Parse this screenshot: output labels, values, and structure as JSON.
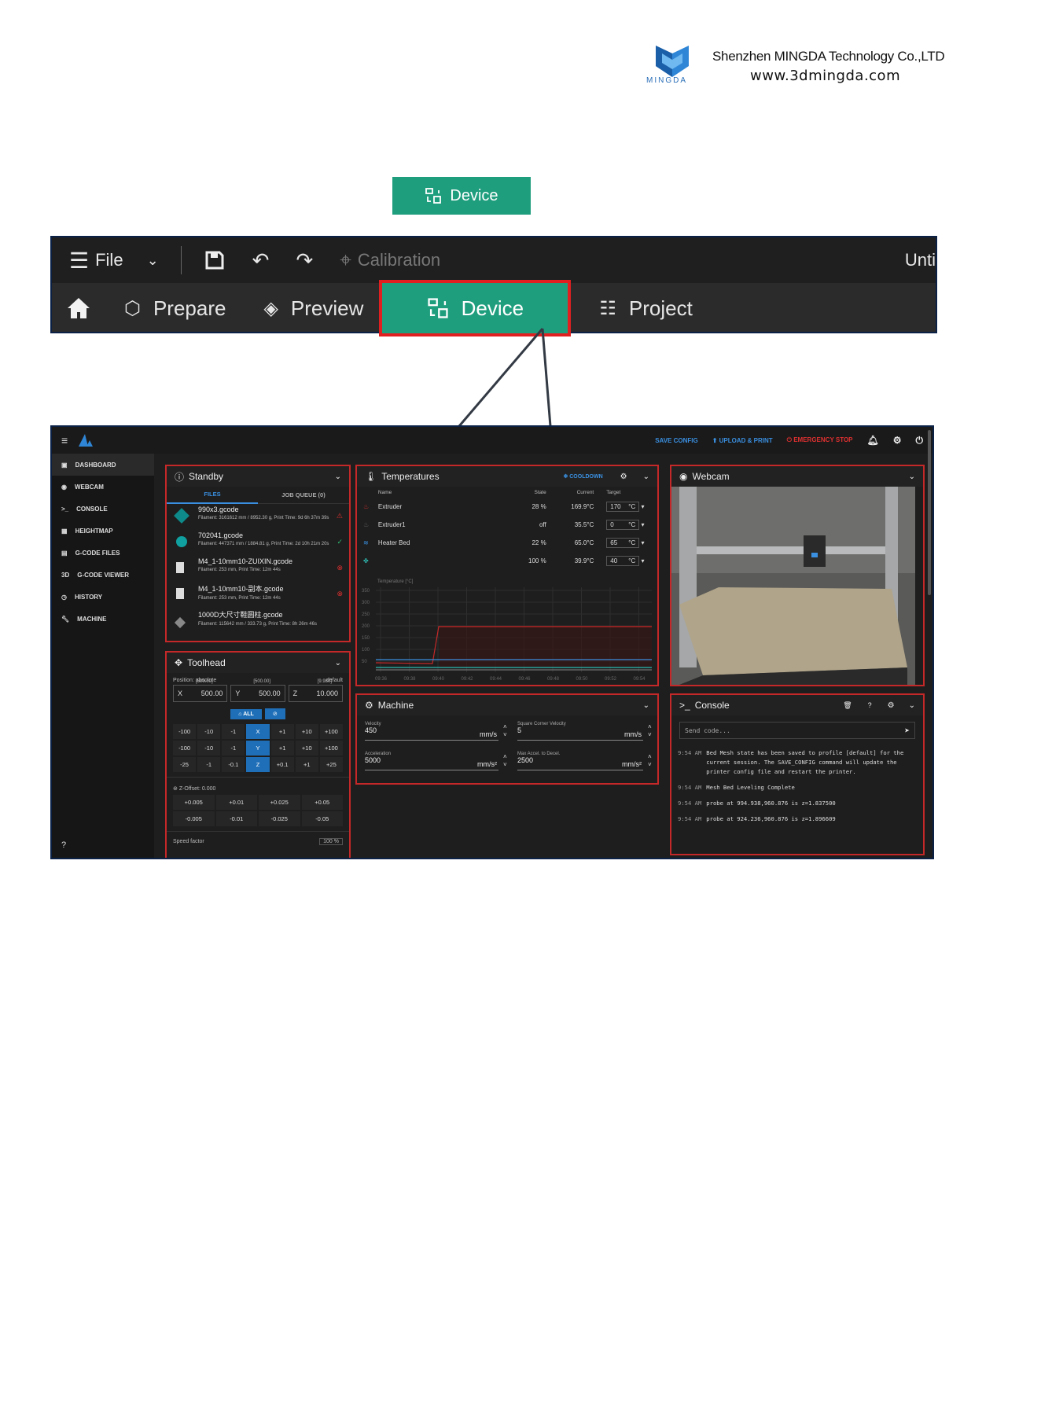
{
  "header": {
    "company": "Shenzhen MINGDA Technology Co.,LTD",
    "url": "www.3dmingda.com",
    "logo_text": "MINGDA"
  },
  "device_chip": {
    "label": "Device"
  },
  "menubar": {
    "file": "File",
    "calibration": "Calibration",
    "title_partial": "Unti"
  },
  "tabs": [
    {
      "label": "Prepare"
    },
    {
      "label": "Preview"
    },
    {
      "label": "Device"
    },
    {
      "label": "Project"
    }
  ],
  "dash": {
    "top": {
      "save_config": "SAVE CONFIG",
      "upload_print": "UPLOAD & PRINT",
      "emergency": "EMERGENCY STOP"
    },
    "sidebar": [
      {
        "label": "DASHBOARD"
      },
      {
        "label": "WEBCAM"
      },
      {
        "label": "CONSOLE"
      },
      {
        "label": "HEIGHTMAP"
      },
      {
        "label": "G-CODE FILES"
      },
      {
        "label": "G-CODE VIEWER"
      },
      {
        "label": "HISTORY"
      },
      {
        "label": "MACHINE"
      }
    ],
    "standby": {
      "title": "Standby",
      "tab_files": "FILES",
      "tab_queue": "JOB QUEUE (0)",
      "files": [
        {
          "name": "990x3.gcode",
          "meta": "Filament: 3161612 mm / 8952.30 g, Print Time: 9d 6h 37m 39s"
        },
        {
          "name": "702041.gcode",
          "meta": "Filament: 447371 mm / 1884.81 g, Print Time: 2d 10h 21m 20s"
        },
        {
          "name": "M4_1-10mm10-ZUIXIN.gcode",
          "meta": "Filament: 253 mm, Print Time: 12m 44s"
        },
        {
          "name": "M4_1-10mm10-副本.gcode",
          "meta": "Filament: 253 mm, Print Time: 12m 44s"
        },
        {
          "name": "1000D大尺寸鞋圆柱.gcode",
          "meta": "Filament: 115642 mm / 333.73 g, Print Time: 8h 26m 46s"
        }
      ]
    },
    "temps": {
      "title": "Temperatures",
      "cooldown": "COOLDOWN",
      "headers": {
        "name": "Name",
        "state": "State",
        "current": "Current",
        "target": "Target"
      },
      "rows": [
        {
          "name": "Extruder",
          "state": "28 %",
          "current": "169.9°C",
          "target": "170",
          "unit": "°C"
        },
        {
          "name": "Extruder1",
          "state": "off",
          "current": "35.5°C",
          "target": "0",
          "unit": "°C"
        },
        {
          "name": "Heater Bed",
          "state": "22 %",
          "current": "65.0°C",
          "target": "65",
          "unit": "°C"
        },
        {
          "name": "",
          "state": "100 %",
          "current": "39.9°C",
          "target": "40",
          "unit": "°C"
        }
      ],
      "chart_label": "Temperature [°C]",
      "yticks": [
        "350",
        "300",
        "250",
        "200",
        "150",
        "100",
        "50"
      ],
      "xticks": [
        "09:36",
        "09:38",
        "09:40",
        "09:42",
        "09:44",
        "09:46",
        "09:48",
        "09:50",
        "09:52",
        "09:54"
      ]
    },
    "webcam": {
      "title": "Webcam"
    },
    "toolhead": {
      "title": "Toolhead",
      "position": "Position: absolute",
      "default": "default",
      "x_label": "X",
      "x_val": "500.00",
      "x_max": "[500.00]",
      "y_label": "Y",
      "y_val": "500.00",
      "y_max": "[500.00]",
      "z_label": "Z",
      "z_val": "10.000",
      "z_max": "[9.980]",
      "all": "ALL",
      "jog_x": [
        "-100",
        "-10",
        "-1",
        "X",
        "+1",
        "+10",
        "+100"
      ],
      "jog_y": [
        "-100",
        "-10",
        "-1",
        "Y",
        "+1",
        "+10",
        "+100"
      ],
      "jog_z": [
        "-25",
        "-1",
        "-0.1",
        "Z",
        "+0.1",
        "+1",
        "+25"
      ],
      "zoffset": "Z-Offset: 0.000",
      "zup": [
        "+0.005",
        "+0.01",
        "+0.025",
        "+0.05"
      ],
      "zdown": [
        "-0.005",
        "-0.01",
        "-0.025",
        "-0.05"
      ],
      "speed": "Speed factor",
      "speed_val": "100"
    },
    "machine": {
      "title": "Machine",
      "velocity_label": "Velocity",
      "velocity": "450",
      "velocity_unit": "mm/s",
      "scv_label": "Square Corner Velocity",
      "scv": "5",
      "scv_unit": "mm/s",
      "accel_label": "Acceleration",
      "accel": "5000",
      "accel_unit": "mm/s²",
      "decel_label": "Max Accel. to Decel.",
      "decel": "2500",
      "decel_unit": "mm/s²"
    },
    "console": {
      "title": "Console",
      "placeholder": "Send code...",
      "lines": [
        {
          "t": "9:54 AM",
          "msg": "Bed Mesh state has been saved to profile [default] for the current session. The SAVE_CONFIG command will update the printer config file and restart the printer."
        },
        {
          "t": "9:54 AM",
          "msg": "Mesh Bed Leveling Complete"
        },
        {
          "t": "9:54 AM",
          "msg": "probe at 994.938,960.876 is z=1.837500"
        },
        {
          "t": "9:54 AM",
          "msg": "probe at 924.236,960.876 is z=1.896609"
        }
      ]
    }
  }
}
